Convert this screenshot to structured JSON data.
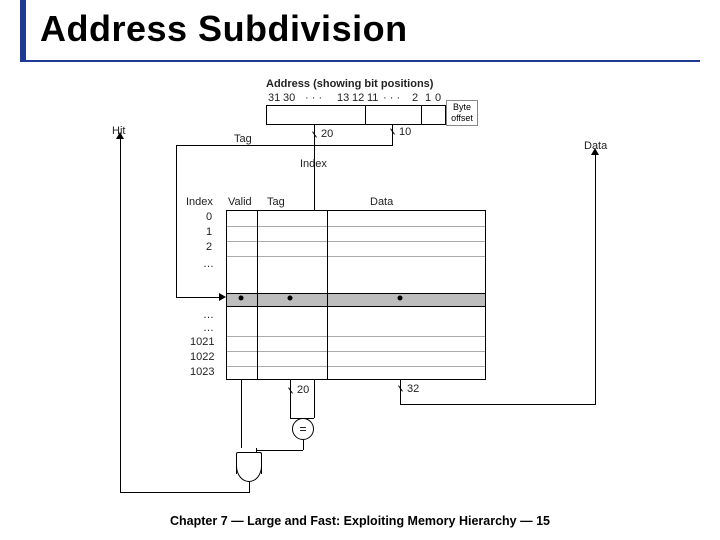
{
  "title": "Address Subdivision",
  "footer": "Chapter 7 — Large and Fast: Exploiting Memory Hierarchy — 15",
  "addr": {
    "caption": "Address (showing bit positions)",
    "bits": {
      "b31": "31",
      "b30": "30",
      "dotsA": "· · ·",
      "b13": "13",
      "b12": "12",
      "b11": "11",
      "dotsB": "· · ·",
      "b2": "2",
      "b1": "1",
      "b0": "0"
    },
    "byte_offset": "Byte\noffset",
    "tag_width": "20",
    "index_width": "10"
  },
  "labels": {
    "hit": "Hit",
    "tag": "Tag",
    "index": "Index",
    "data": "Data",
    "col_index": "Index",
    "col_valid": "Valid",
    "col_tag": "Tag",
    "col_data": "Data",
    "tag_cmp_width": "20",
    "data_width": "32",
    "eq": "="
  },
  "rows": {
    "r0": "0",
    "r1": "1",
    "r2": "2",
    "dots1": "…",
    "dots2": "…",
    "dots3": "…",
    "r1021": "1021",
    "r1022": "1022",
    "r1023": "1023"
  }
}
